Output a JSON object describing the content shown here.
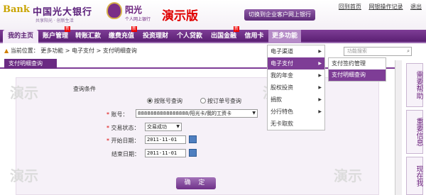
{
  "header": {
    "logo_mark": "Bank",
    "bank_name": "中国光大银行",
    "slogan": "共享阳光 · 创新生活",
    "brand_title": "阳光",
    "brand_sub": "个人网上银行",
    "demo_badge": "演示版",
    "switch_button": "切换到企业客户网上银行",
    "links": [
      "回到首页",
      "网银操作记录",
      "退出"
    ]
  },
  "nav": {
    "items": [
      {
        "label": "我的主页",
        "active": true
      },
      {
        "label": "账户管理",
        "new": true
      },
      {
        "label": "转账汇款"
      },
      {
        "label": "缴费充值",
        "new": true
      },
      {
        "label": "投资理财"
      },
      {
        "label": "个人贷款"
      },
      {
        "label": "出国金融",
        "new": true
      },
      {
        "label": "信用卡"
      },
      {
        "label": "更多功能",
        "more": true
      }
    ],
    "new_tag": "新"
  },
  "breadcrumb": {
    "prefix": "当前位置：",
    "path": [
      "更多功能",
      "电子支付",
      "支付明细查询"
    ]
  },
  "site_search": {
    "placeholder": "功能搜索"
  },
  "tab": {
    "label": "支付明细查询"
  },
  "watermark": "演示",
  "form": {
    "section_title": "查询条件",
    "radio_options": [
      {
        "label": "按账号查询",
        "checked": true
      },
      {
        "label": "按订单号查询",
        "checked": false
      }
    ],
    "account_label": "账号：",
    "account_value": "8888888888888888/阳光卡/我的工资卡",
    "status_label": "交易状态：",
    "status_value": "交易成功",
    "start_label": "开始日期：",
    "start_value": "2011-11-01",
    "end_label": "结束日期：",
    "end_value": "2011-11-01",
    "confirm_button": "确 定"
  },
  "dropdown_menu": {
    "items": [
      {
        "label": "电子渠道",
        "has_sub": true
      },
      {
        "label": "电子支付",
        "has_sub": true,
        "selected": true
      },
      {
        "label": "我的年金",
        "has_sub": true
      },
      {
        "label": "股权投资",
        "has_sub": true
      },
      {
        "label": "捐款",
        "has_sub": true
      },
      {
        "label": "分行特色",
        "has_sub": true
      },
      {
        "label": "无卡取款"
      }
    ],
    "submenu": [
      {
        "label": "支付签约管理"
      },
      {
        "label": "支付明细查询",
        "selected": true
      }
    ]
  },
  "right_sidebar": [
    "需要帮助",
    "重要信息",
    "现在我"
  ],
  "colors": {
    "brand_purple": "#6a1f7c",
    "demo_red": "#e00000"
  }
}
